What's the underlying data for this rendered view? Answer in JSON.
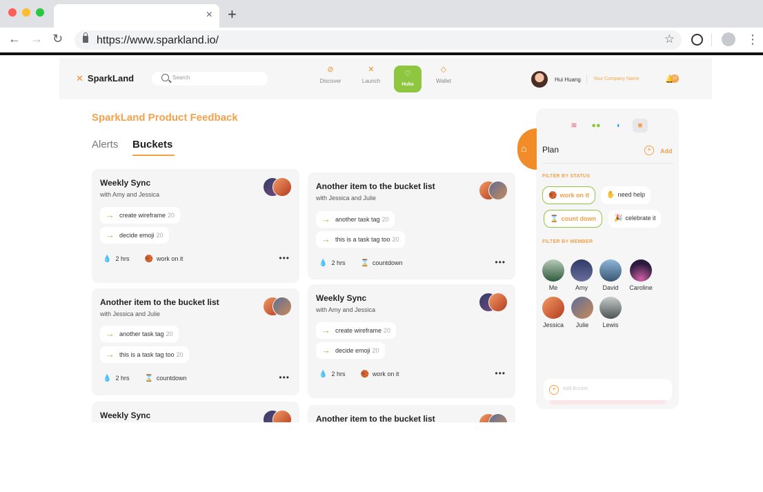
{
  "browser": {
    "url": "https://www.sparkland.io/",
    "tab_close": "×",
    "new_tab": "+",
    "back": "←",
    "forward": "→",
    "reload": "↻",
    "bookmark": "☆",
    "menu": "⋮"
  },
  "header": {
    "logo": "SparkLand",
    "search_placeholder": "Search",
    "nav": [
      {
        "label": "Discover",
        "icon": "compass-icon",
        "glyph": "⊘"
      },
      {
        "label": "Launch",
        "icon": "spark-icon",
        "glyph": "✕"
      },
      {
        "label": "Hubs",
        "icon": "hub-icon",
        "glyph": "♡",
        "active": true
      },
      {
        "label": "Wallet",
        "icon": "wallet-icon",
        "glyph": "◇"
      }
    ],
    "user_name": "Hui Huang",
    "company": "Your Company Name",
    "notification_count": "10"
  },
  "main": {
    "title": "SparkLand Product Feedback",
    "tabs": [
      "Alerts",
      "Buckets"
    ],
    "active_tab": "Buckets"
  },
  "cards": [
    {
      "title": "Weekly Sync",
      "subtitle": "with Amy and Jessica",
      "tags": [
        {
          "label": "create wireframe",
          "count": "20"
        },
        {
          "label": "decide emoji",
          "count": "20"
        }
      ],
      "duration": "2 hrs",
      "status": "work on it"
    },
    {
      "title": "Another item to the bucket list",
      "subtitle": "with Jessica and Julie",
      "tags": [
        {
          "label": "another task tag",
          "count": "20"
        },
        {
          "label": "this is a task tag too",
          "count": "20"
        }
      ],
      "duration": "2 hrs",
      "status": "countdown"
    },
    {
      "title": "Another item to the bucket list",
      "subtitle": "with Jessica and Julie",
      "tags": [
        {
          "label": "another task tag",
          "count": "20"
        },
        {
          "label": "this is a task tag too",
          "count": "20"
        }
      ],
      "duration": "2 hrs",
      "status": "countdown"
    },
    {
      "title": "Weekly Sync",
      "subtitle": "with Amy and Jessica",
      "tags": [
        {
          "label": "create wireframe",
          "count": "20"
        },
        {
          "label": "decide emoji",
          "count": "20"
        }
      ],
      "duration": "2 hrs",
      "status": "work on it"
    },
    {
      "title": "Weekly Sync"
    },
    {
      "title": "Another item to the bucket list"
    }
  ],
  "panel": {
    "title": "Plan",
    "add_label": "Add",
    "filter_status_label": "FILTER BY STATUS",
    "statuses": [
      {
        "label": "work on it",
        "selected": true
      },
      {
        "label": "need help",
        "selected": false
      },
      {
        "label": "count down",
        "selected": true
      },
      {
        "label": "celebrate it",
        "selected": false
      }
    ],
    "filter_member_label": "FILTER BY MEMBER",
    "members": [
      "Me",
      "Amy",
      "David",
      "Caroline",
      "Jessica",
      "Julie",
      "Lewis"
    ],
    "add_bucket_placeholder": "Add Bucket"
  },
  "colors": {
    "accent_orange": "#f5a04a",
    "accent_green": "#8ec63f",
    "card_bg": "#f5f5f6"
  }
}
